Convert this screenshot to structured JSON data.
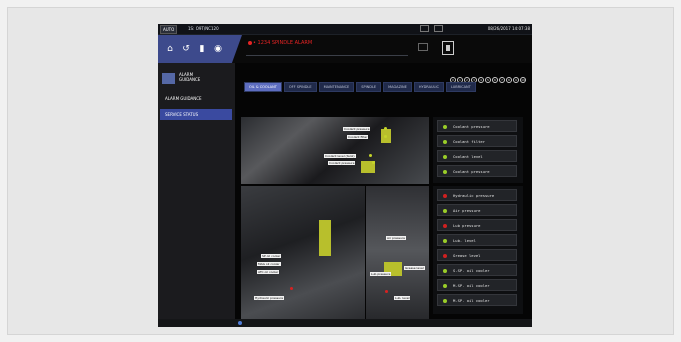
{
  "topbar": {
    "mode": "AUTO",
    "program": "1S: O9T/NC120",
    "status": "08/26/2017 14:07:38"
  },
  "navbar": {
    "alarm_message": "• 1234 SPINDLE ALARM"
  },
  "sidebar": {
    "title_line1": "ALARM",
    "title_line2": "GUIDANCE",
    "items": [
      {
        "label": "ALARM GUIDANCE",
        "icon": "list-icon"
      },
      {
        "label": "SERVICE STATUS",
        "icon": "tool-icon"
      }
    ]
  },
  "legend": {
    "items": [
      "0",
      "1",
      "2",
      "3",
      "4",
      "5",
      "6",
      "7",
      "8",
      "9",
      "10"
    ]
  },
  "tabs": [
    {
      "label": "OIL & COOLANT",
      "active": true
    },
    {
      "label": "OFF SPINDLE",
      "active": false
    },
    {
      "label": "MAINTENANCE",
      "active": false
    },
    {
      "label": "SPINDLE",
      "active": false
    },
    {
      "label": "MAGAZINE",
      "active": false
    },
    {
      "label": "HYDRAULIC",
      "active": false
    },
    {
      "label": "LUBRICANT",
      "active": false
    }
  ],
  "callouts": [
    "Coolant pressure",
    "Coolant filter",
    "Coolant level (tank)",
    "Coolant pressure",
    "SP oil cooler",
    "MAG oil cooler",
    "ATC oil cooler",
    "Hydraulic pressure",
    "Air pressure",
    "Lub pressure",
    "Grease level",
    "Lub. level"
  ],
  "panel_top": [
    {
      "label": "Coolant pressure",
      "status": "ok"
    },
    {
      "label": "Coolant filter",
      "status": "ok"
    },
    {
      "label": "Coolant level",
      "status": "ok"
    },
    {
      "label": "Coolant pressure",
      "status": "ok"
    }
  ],
  "panel_bottom": [
    {
      "label": "Hydraulic pressure",
      "status": "alarm"
    },
    {
      "label": "Air pressure",
      "status": "ok"
    },
    {
      "label": "Lub pressure",
      "status": "alarm"
    },
    {
      "label": "Lub. level",
      "status": "ok"
    },
    {
      "label": "Grease level",
      "status": "alarm"
    },
    {
      "label": "S.SP. oil cooler",
      "status": "ok"
    },
    {
      "label": "M.SP. oil cooler",
      "status": "ok"
    },
    {
      "label": "M.SP. oil cooler",
      "status": "ok"
    }
  ]
}
